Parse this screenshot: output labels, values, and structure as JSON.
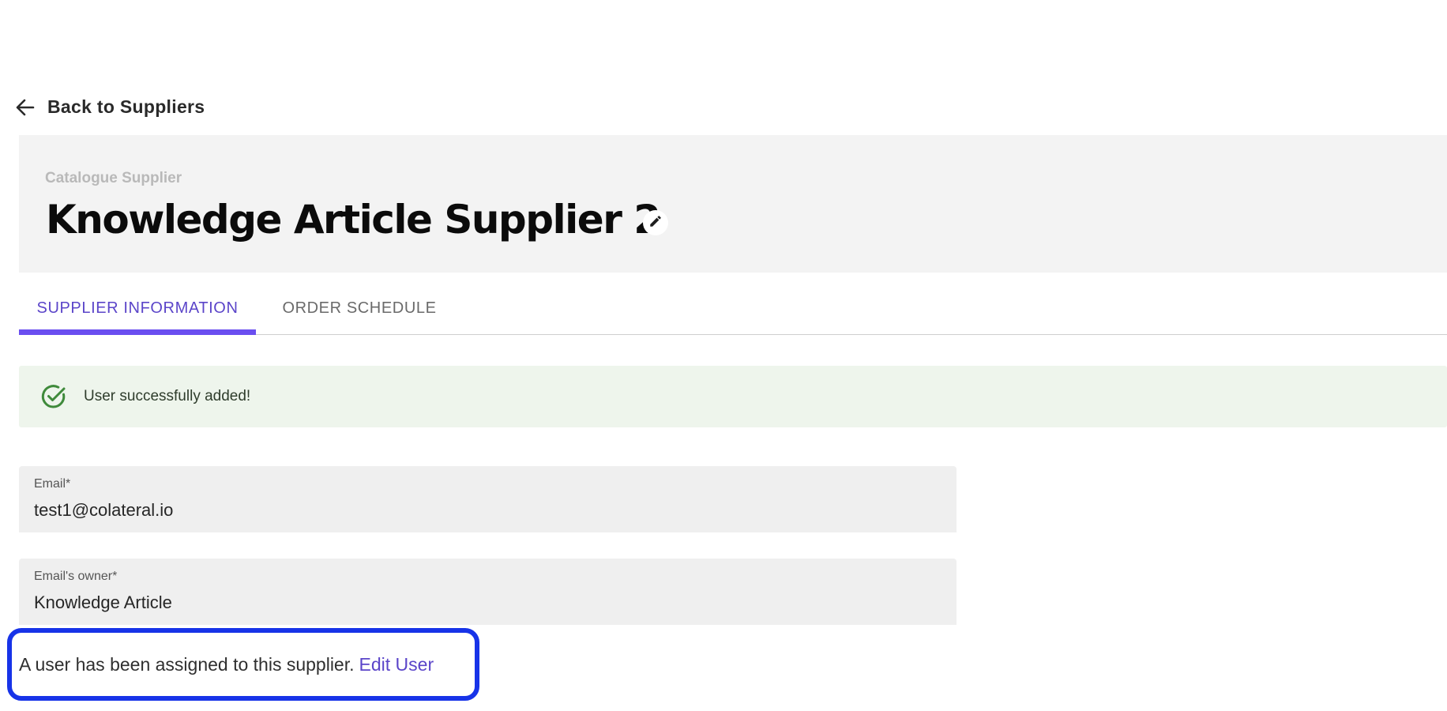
{
  "nav": {
    "back_label": "Back to Suppliers",
    "back_icon": "arrow-left-icon"
  },
  "header": {
    "eyebrow": "Catalogue Supplier",
    "title": "Knowledge Article Supplier 2",
    "edit_icon": "pencil-icon"
  },
  "tabs": [
    {
      "label": "SUPPLIER INFORMATION",
      "active": true
    },
    {
      "label": "ORDER SCHEDULE",
      "active": false
    }
  ],
  "alert": {
    "icon": "check-circle-icon",
    "message": "User successfully added!"
  },
  "form": {
    "email": {
      "label": "Email",
      "required_mark": "*",
      "value": "test1@colateral.io"
    },
    "owner": {
      "label": "Email's owner",
      "required_mark": "*",
      "value": "Knowledge Article"
    }
  },
  "assignment": {
    "text": "A user has been assigned to this supplier.",
    "link_label": "Edit User"
  },
  "colors": {
    "accent": "#6a4ef0",
    "tab_active_text": "#5b45c9",
    "success_bg": "#eef5ec",
    "success_icon": "#3f8a3b",
    "highlight_border": "#1733e8"
  }
}
